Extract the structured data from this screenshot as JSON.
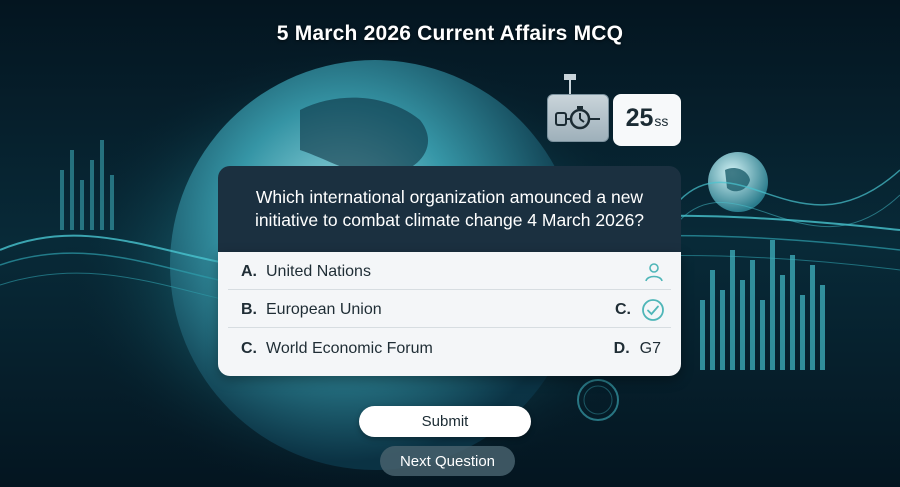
{
  "title": "5 March 2026 Current Affairs MCQ",
  "timer": {
    "value": "25",
    "unit": "ss",
    "icon": "stopwatch-icon"
  },
  "question": {
    "line1": "Which international organization amounced a new",
    "line2": "initiative to combat climate change 4 March 2026?"
  },
  "options": [
    {
      "letter": "A.",
      "text": "United Nations",
      "right_icon": "person-icon"
    },
    {
      "letter": "B.",
      "text": "European Union",
      "right_letter": "C.",
      "right_icon": "check-circle-icon"
    },
    {
      "letter": "C.",
      "text": "World Economic Forum",
      "right_letter": "D.",
      "right_text": "G7"
    }
  ],
  "buttons": {
    "submit": "Submit",
    "next": "Next Question"
  },
  "colors": {
    "background": "#051a26",
    "question_bg": "#1b3040",
    "accent": "#4fb6b8",
    "options_bg": "#f4f6f8"
  }
}
